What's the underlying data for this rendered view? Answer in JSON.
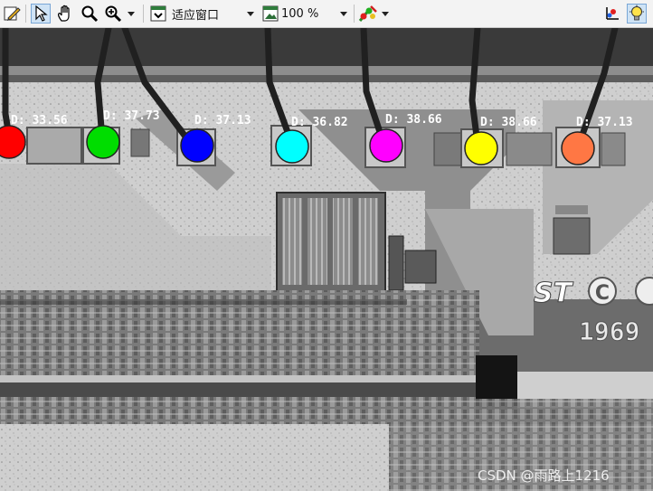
{
  "toolbar": {
    "fit_label": "适应窗口",
    "zoom_value": "100 %",
    "icons": [
      "edit-icon",
      "pointer-icon",
      "hand-pan-icon",
      "magnifier-icon",
      "zoom-in-icon",
      "fit-window-icon",
      "zoom-image-icon",
      "color-tool-icon",
      "coordinate-axes-icon",
      "lightbulb-icon"
    ]
  },
  "markers": [
    {
      "label": "D: 33.56",
      "color": "#ff0000"
    },
    {
      "label": "D: 37.73",
      "color": "#00dd00"
    },
    {
      "label": "D: 37.13",
      "color": "#0000ff"
    },
    {
      "label": "D: 36.82",
      "color": "#00ffff"
    },
    {
      "label": "D: 38.66",
      "color": "#ff00ff"
    },
    {
      "label": "D: 38.66",
      "color": "#ffff00"
    },
    {
      "label": "D: 37.13",
      "color": "#ff7744"
    }
  ],
  "chip": {
    "logo_text": "ST",
    "c_mark": "C",
    "year": "1969"
  },
  "watermark": "CSDN @雨路上1216"
}
